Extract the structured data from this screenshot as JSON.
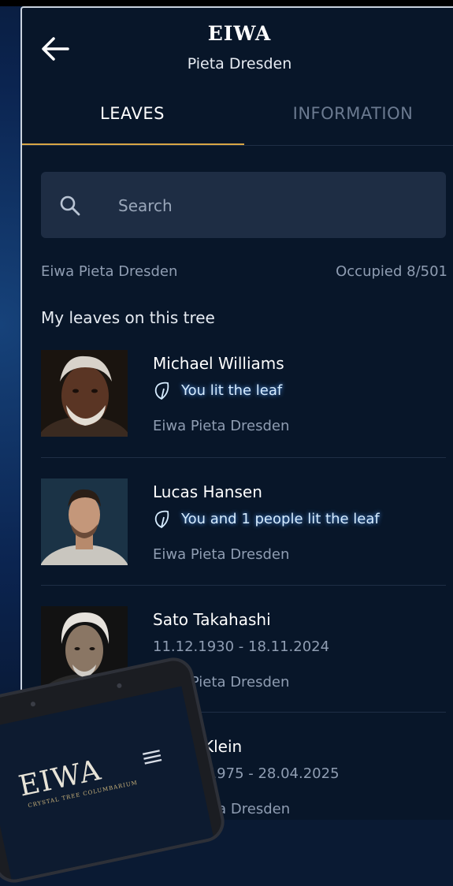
{
  "header": {
    "title": "EIWA",
    "subtitle": "Pieta Dresden",
    "back_icon": "arrow-left-icon"
  },
  "tabs": [
    {
      "label": "LEAVES",
      "active": true
    },
    {
      "label": "INFORMATION",
      "active": false
    }
  ],
  "search": {
    "placeholder": "Search",
    "value": "",
    "icon": "search-icon"
  },
  "tree": {
    "name": "Eiwa Pieta Dresden",
    "occupied": "Occupied 8/501"
  },
  "section_title": "My leaves on this tree",
  "leaves": [
    {
      "name": "Michael Williams",
      "status": "You lit the leaf",
      "location": "Eiwa Pieta Dresden"
    },
    {
      "name": "Lucas Hansen",
      "status": "You and 1 people lit the leaf",
      "location": "Eiwa Pieta Dresden"
    },
    {
      "name": "Sato Takahashi",
      "dates": "11.12.1930 - 18.11.2024",
      "location": "Eiwa Pieta Dresden"
    },
    {
      "name": "Klein",
      "dates": ".1975 - 28.04.2025",
      "location": "eta Dresden"
    }
  ],
  "overlay_device": {
    "logo": "EIWA",
    "logo_sub": "CRYSTAL TREE COLUMBARIUM",
    "menu_icon": "hamburger-menu-icon"
  },
  "colors": {
    "background": "#081629",
    "accent": "#d8a645",
    "lit_glow": "#4f9cff",
    "muted_text": "#8f9db2"
  }
}
